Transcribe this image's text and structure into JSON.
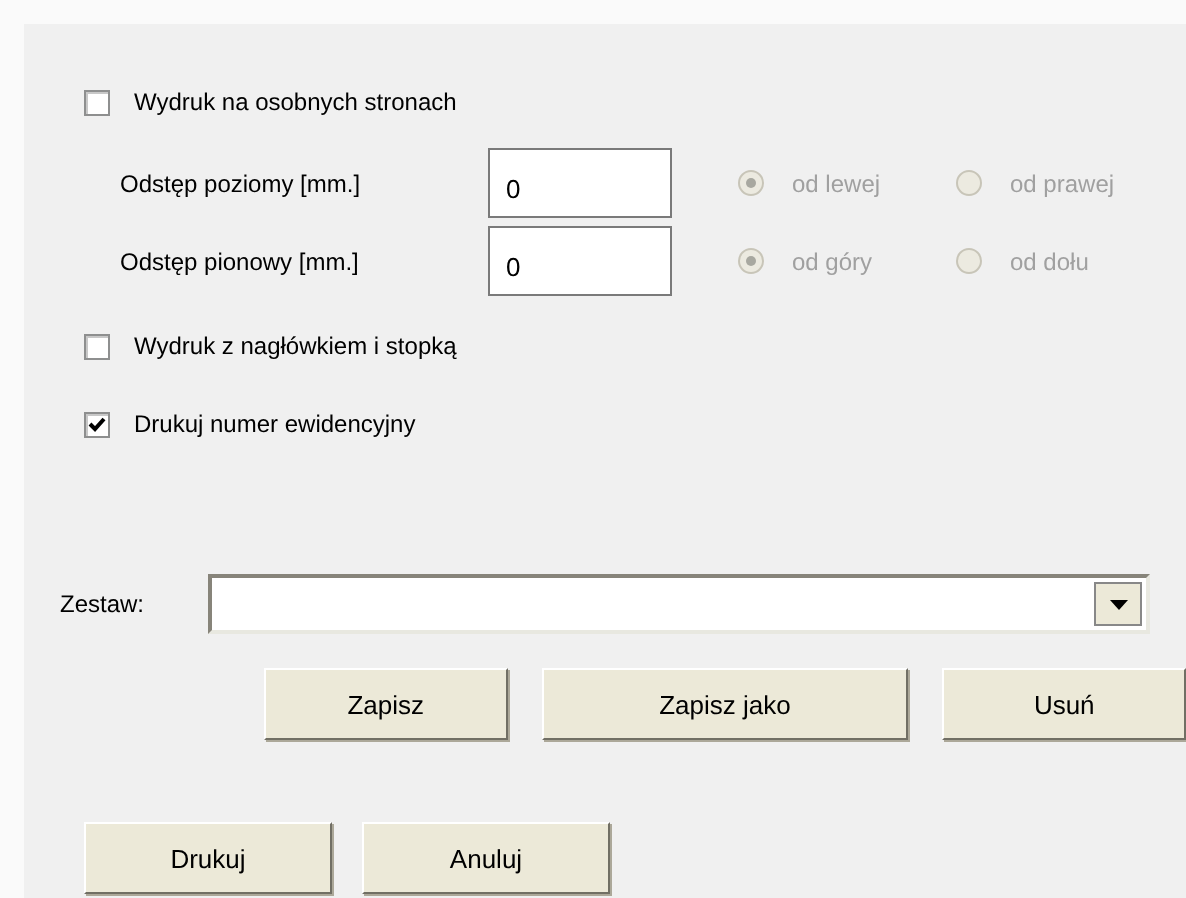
{
  "separate_pages": {
    "label": "Wydruk na osobnych stronach",
    "checked": false
  },
  "spacing": [
    {
      "label": "Odstęp poziomy [mm.]",
      "value": "0",
      "radios": [
        {
          "label": "od lewej",
          "selected": true,
          "disabled": true
        },
        {
          "label": "od prawej",
          "selected": false,
          "disabled": true
        }
      ]
    },
    {
      "label": "Odstęp pionowy [mm.]",
      "value": "0",
      "radios": [
        {
          "label": "od góry",
          "selected": true,
          "disabled": true
        },
        {
          "label": "od dołu",
          "selected": false,
          "disabled": true
        }
      ]
    }
  ],
  "options": [
    {
      "label": "Wydruk z nagłówkiem i stopką",
      "checked": false
    },
    {
      "label": "Drukuj numer ewidencyjny",
      "checked": true
    }
  ],
  "preset": {
    "label": "Zestaw:"
  },
  "preset_buttons": [
    "Zapisz",
    "Zapisz jako",
    "Usuń"
  ],
  "buttons": [
    "Drukuj",
    "Anuluj"
  ]
}
